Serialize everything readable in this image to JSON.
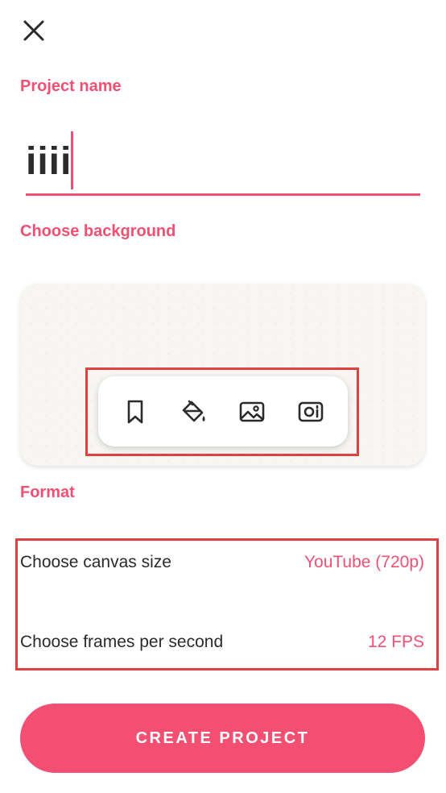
{
  "project_name": {
    "label": "Project name",
    "value": "iiii"
  },
  "background": {
    "label": "Choose background",
    "tools": [
      {
        "icon": "bookmark-icon"
      },
      {
        "icon": "paint-bucket-icon"
      },
      {
        "icon": "image-icon"
      },
      {
        "icon": "camera-icon"
      }
    ]
  },
  "format": {
    "label": "Format",
    "canvas_size": {
      "label": "Choose canvas size",
      "value": "YouTube (720p)"
    },
    "fps": {
      "label": "Choose frames per second",
      "value": "12 FPS"
    }
  },
  "actions": {
    "create_label": "CREATE PROJECT"
  },
  "colors": {
    "accent": "#f24f73",
    "highlight": "#e0403f"
  }
}
